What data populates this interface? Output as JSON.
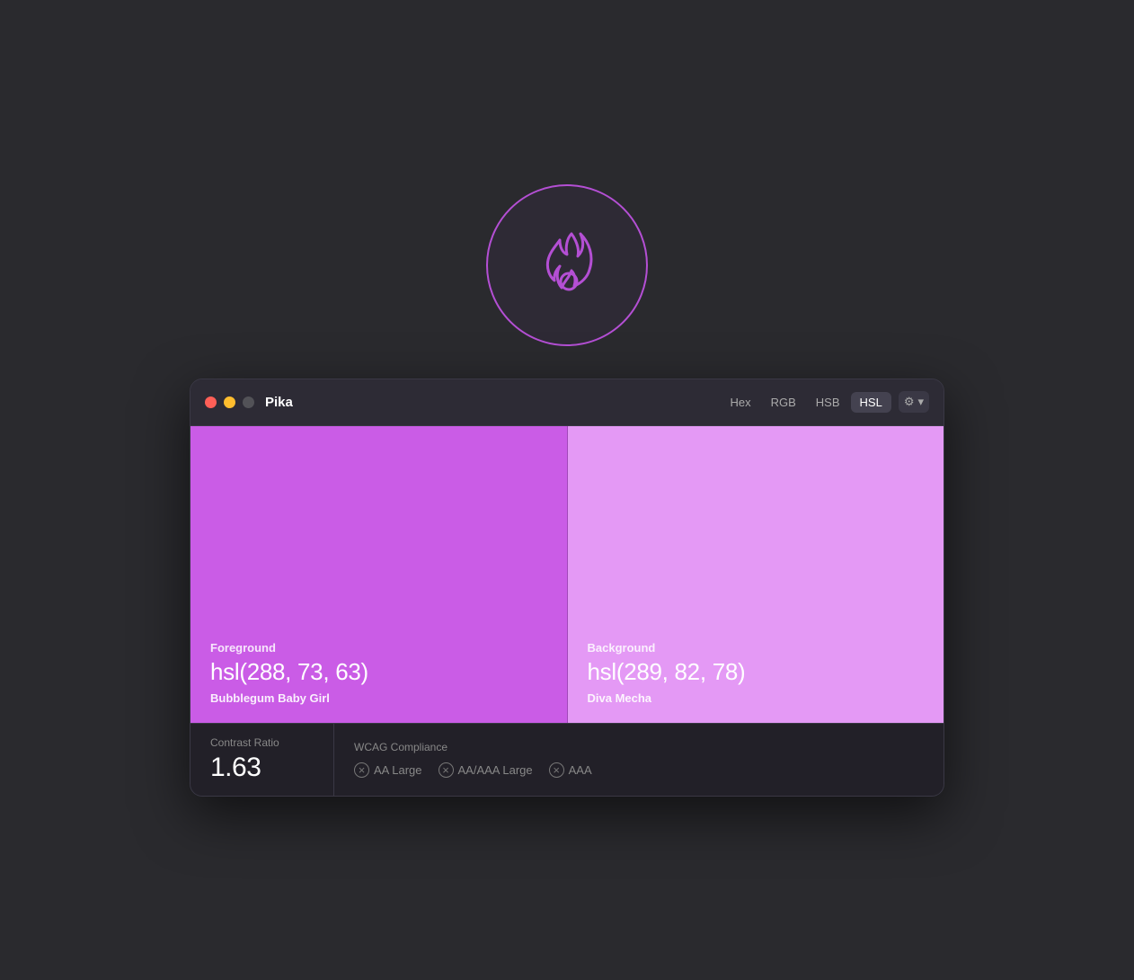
{
  "app": {
    "icon_label": "Pika fire icon",
    "title": "Pika"
  },
  "titlebar": {
    "traffic_lights": [
      {
        "name": "close",
        "label": "close"
      },
      {
        "name": "minimize",
        "label": "minimize"
      },
      {
        "name": "maximize",
        "label": "maximize"
      }
    ],
    "format_tabs": [
      {
        "id": "hex",
        "label": "Hex",
        "active": false
      },
      {
        "id": "rgb",
        "label": "RGB",
        "active": false
      },
      {
        "id": "hsb",
        "label": "HSB",
        "active": false
      },
      {
        "id": "hsl",
        "label": "HSL",
        "active": true
      }
    ],
    "settings_label": "⚙",
    "chevron_label": "▾"
  },
  "foreground": {
    "label": "Foreground",
    "value": "hsl(288, 73, 63)",
    "name": "Bubblegum Baby Girl"
  },
  "background": {
    "label": "Background",
    "value": "hsl(289, 82, 78)",
    "name": "Diva Mecha"
  },
  "contrast": {
    "label": "Contrast Ratio",
    "value": "1.63"
  },
  "wcag": {
    "label": "WCAG Compliance",
    "badges": [
      {
        "id": "aa-large",
        "label": "AA Large"
      },
      {
        "id": "aa-aaa-large",
        "label": "AA/AAA Large"
      },
      {
        "id": "aaa",
        "label": "AAA"
      }
    ]
  }
}
